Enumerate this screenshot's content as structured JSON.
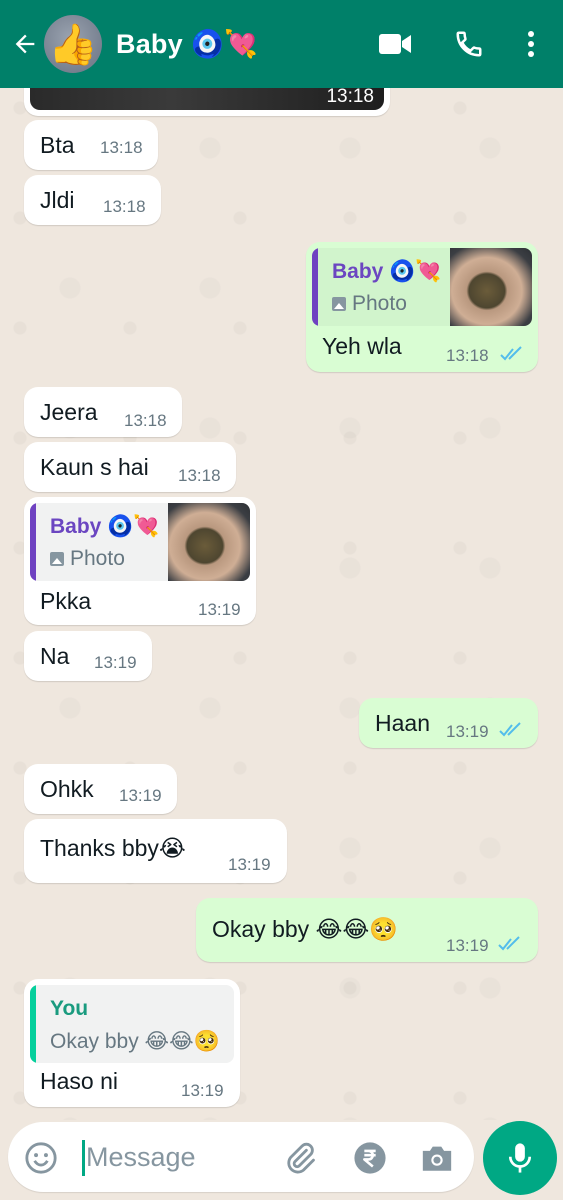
{
  "header": {
    "contact_name": "Baby 🧿💘",
    "avatar_emoji": "👍",
    "icons": [
      "back-arrow-icon",
      "video-call-icon",
      "phone-call-icon",
      "more-options-icon"
    ]
  },
  "colors": {
    "header": "#008069",
    "chat_bg": "#efe7de",
    "incoming_bubble": "#ffffff",
    "outgoing_bubble": "#d9fdd3",
    "read_ticks": "#53bdeb",
    "accent": "#00a884"
  },
  "messages": [
    {
      "dir": "in",
      "text": "",
      "time": "13:18",
      "kind": "image-cutoff"
    },
    {
      "dir": "in",
      "text": "Bta",
      "time": "13:18"
    },
    {
      "dir": "in",
      "text": "Jldi",
      "time": "13:18"
    },
    {
      "dir": "out",
      "text": "Yeh wla",
      "time": "13:18",
      "ticks": "read",
      "reply": {
        "author": "Baby 🧿💘",
        "text": "Photo",
        "has_thumb": true
      }
    },
    {
      "dir": "in",
      "text": "Jeera",
      "time": "13:18"
    },
    {
      "dir": "in",
      "text": "Kaun s hai",
      "time": "13:18"
    },
    {
      "dir": "in",
      "text": "Pkka",
      "time": "13:19",
      "reply": {
        "author": "Baby 🧿💘",
        "text": "Photo",
        "has_thumb": true
      }
    },
    {
      "dir": "in",
      "text": "Na",
      "time": "13:19"
    },
    {
      "dir": "out",
      "text": "Haan",
      "time": "13:19",
      "ticks": "read"
    },
    {
      "dir": "in",
      "text": "Ohkk",
      "time": "13:19"
    },
    {
      "dir": "in",
      "text": "Thanks bby😭",
      "time": "13:19"
    },
    {
      "dir": "out",
      "text": "Okay bby 😂😂🥺",
      "time": "13:19",
      "ticks": "read"
    },
    {
      "dir": "in",
      "text": "Haso ni",
      "time": "13:19",
      "reply": {
        "author": "You",
        "text": "Okay bby 😂😂🥺",
        "has_thumb": false
      }
    }
  ],
  "composer": {
    "placeholder": "Message",
    "icons": [
      "emoji-icon",
      "attach-icon",
      "rupee-payment-icon",
      "camera-icon",
      "mic-icon"
    ]
  }
}
